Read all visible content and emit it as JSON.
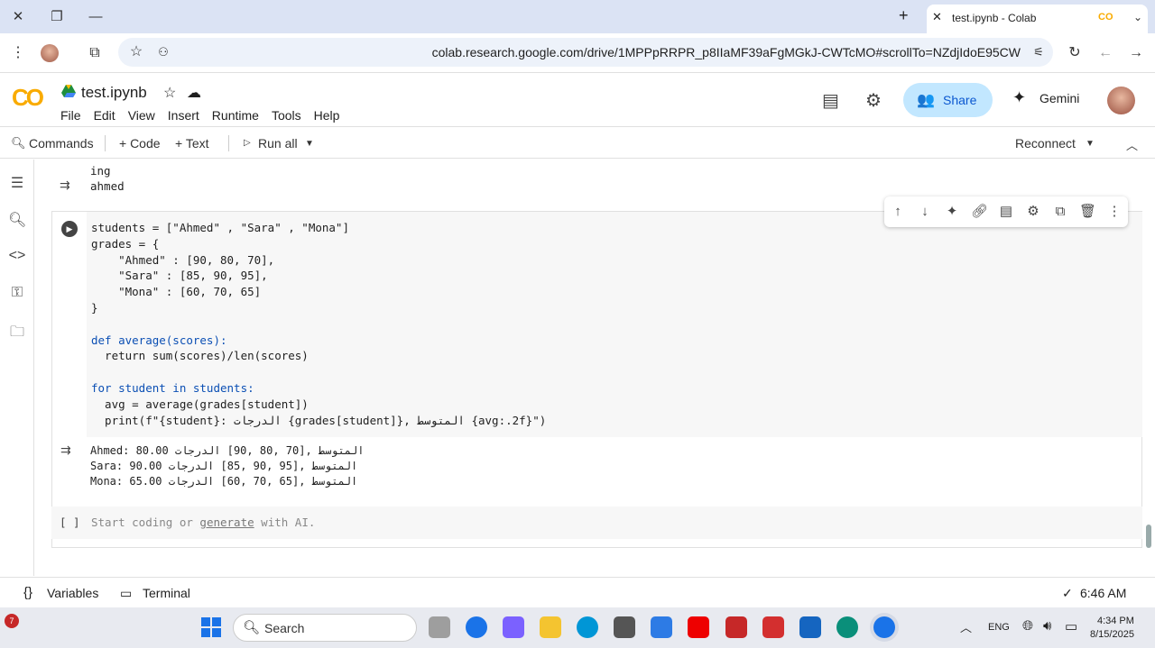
{
  "browser": {
    "tab_title": "test.ipynb - Colab",
    "url": "colab.research.google.com/drive/1MPPpRRPR_p8IIaMF39aFgMGkJ-CWTcMO#scrollTo=NZdjIdoE95CW",
    "new_tab": "+",
    "tab_close": "✕",
    "tab_favicon": "CO"
  },
  "colab": {
    "logo": "CO",
    "file_name": "test.ipynb",
    "menu": [
      "File",
      "Edit",
      "View",
      "Insert",
      "Runtime",
      "Tools",
      "Help"
    ],
    "share_label": "Share",
    "gemini_label": "Gemini"
  },
  "toolbar": {
    "commands": "Commands",
    "code": "+ Code",
    "text": "+ Text",
    "run_all": "Run all",
    "reconnect": "Reconnect"
  },
  "prev_output": {
    "lines": [
      "ing",
      "ahmed"
    ]
  },
  "cell": {
    "code_lines": [
      "students = [\"Ahmed\" , \"Sara\" , \"Mona\"]",
      "grades = {",
      "    \"Ahmed\" : [90, 80, 70],",
      "    \"Sara\" : [85, 90, 95],",
      "    \"Mona\" : [60, 70, 65]",
      "}",
      "",
      "def average(scores):",
      "  return sum(scores)/len(scores)",
      "",
      "for student in students:",
      "  avg = average(grades[student])",
      "  print(f\"{student}: الدرجات {grades[student]}, المتوسط {avg:.2f}\")"
    ],
    "output_lines": [
      "Ahmed: 80.00 المتوسط ,[70 ,80 ,90] الدرجات",
      "Sara: 90.00 المتوسط ,[95 ,90 ,85] الدرجات",
      "Mona: 65.00 المتوسط ,[65 ,70 ,60] الدرجات"
    ]
  },
  "new_cell": {
    "brackets": "[ ]",
    "placeholder_prefix": "Start coding or",
    "placeholder_link": "generate",
    "placeholder_suffix": "with AI."
  },
  "status": {
    "variables": "Variables",
    "terminal": "Terminal",
    "time": "6:46 AM",
    "check": "✓"
  },
  "taskbar": {
    "search": "Search",
    "lang": "ENG",
    "clock_time": "4:34 PM",
    "clock_date": "8/15/2025",
    "notification_count": "7"
  },
  "colors": {
    "accent": "#0b57d0",
    "share_bg": "#c2e7ff",
    "logo": "#f9ab00"
  }
}
